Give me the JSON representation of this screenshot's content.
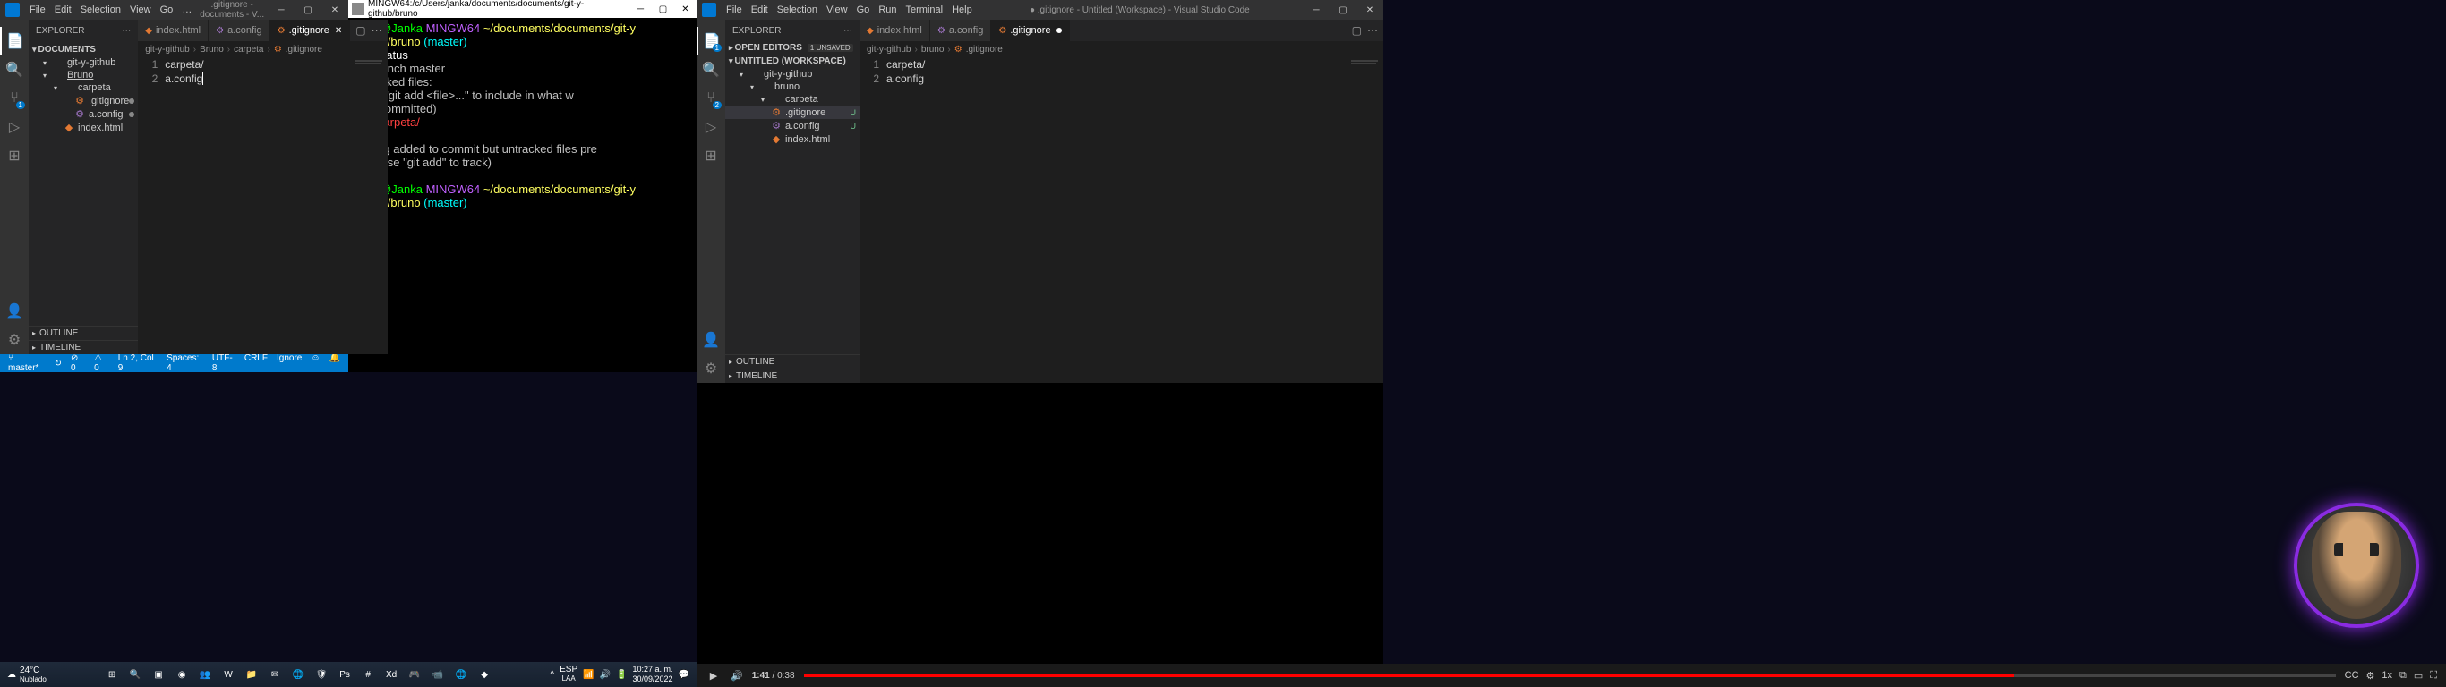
{
  "left_vscode": {
    "menu": [
      "File",
      "Edit",
      "Selection",
      "View",
      "Go"
    ],
    "title": ".gitignore - documents - V...",
    "tabs": [
      {
        "icon": "html",
        "label": "index.html",
        "active": false
      },
      {
        "icon": "config",
        "label": "a.config",
        "active": false
      },
      {
        "icon": "gitignore",
        "label": ".gitignore",
        "active": true
      }
    ],
    "breadcrumbs": [
      "git-y-github",
      "Bruno",
      "carpeta",
      ".gitignore"
    ],
    "explorer": {
      "title": "EXPLORER",
      "root": "DOCUMENTS",
      "tree": [
        {
          "type": "folder",
          "label": "git-y-github",
          "level": 0
        },
        {
          "type": "folder",
          "label": "Bruno",
          "level": 0,
          "underline": true
        },
        {
          "type": "folder",
          "label": "carpeta",
          "level": 1
        },
        {
          "type": "file",
          "label": ".gitignore",
          "icon": "gitignore",
          "level": 2,
          "modified": true
        },
        {
          "type": "file",
          "label": "a.config",
          "icon": "config",
          "level": 2,
          "modified": true
        },
        {
          "type": "file",
          "label": "index.html",
          "icon": "html",
          "level": 1
        }
      ],
      "panels": [
        "OUTLINE",
        "TIMELINE"
      ]
    },
    "editor": {
      "lines": [
        "carpeta/",
        "a.config"
      ]
    },
    "statusbar": {
      "branch": "master*",
      "sync": "↻",
      "errors": "⊘ 0",
      "warnings": "⚠ 0",
      "position": "Ln 2, Col 9",
      "spaces": "Spaces: 4",
      "encoding": "UTF-8",
      "eol": "CRLF",
      "lang": "Ignore",
      "feedback": "☺",
      "bell": "🔔"
    }
  },
  "terminal": {
    "title": "MINGW64:/c/Users/janka/documents/documents/git-y-github/bruno",
    "lines": [
      {
        "segments": [
          {
            "t": "janka@Janka ",
            "c": "green"
          },
          {
            "t": "MINGW64 ",
            "c": "purple"
          },
          {
            "t": "~/documents/documents/git-y",
            "c": "yellow"
          }
        ]
      },
      {
        "segments": [
          {
            "t": "-github/bruno ",
            "c": "yellow"
          },
          {
            "t": "(master)",
            "c": "cyan"
          }
        ]
      },
      {
        "segments": [
          {
            "t": "$ git status",
            "c": "white"
          }
        ]
      },
      {
        "segments": [
          {
            "t": "On branch master",
            "c": ""
          }
        ]
      },
      {
        "segments": [
          {
            "t": "Untracked files:",
            "c": ""
          }
        ]
      },
      {
        "segments": [
          {
            "t": "  (use \"git add <file>...\" to include in what w",
            "c": ""
          }
        ]
      },
      {
        "segments": [
          {
            "t": "ill be committed)",
            "c": ""
          }
        ]
      },
      {
        "segments": [
          {
            "t": "        carpeta/",
            "c": "red"
          }
        ]
      },
      {
        "segments": [
          {
            "t": "",
            "c": ""
          }
        ]
      },
      {
        "segments": [
          {
            "t": "nothing added to commit but untracked files pre",
            "c": ""
          }
        ]
      },
      {
        "segments": [
          {
            "t": "sent (use \"git add\" to track)",
            "c": ""
          }
        ]
      },
      {
        "segments": [
          {
            "t": "",
            "c": ""
          }
        ]
      },
      {
        "segments": [
          {
            "t": "janka@Janka ",
            "c": "green"
          },
          {
            "t": "MINGW64 ",
            "c": "purple"
          },
          {
            "t": "~/documents/documents/git-y",
            "c": "yellow"
          }
        ]
      },
      {
        "segments": [
          {
            "t": "-github/bruno ",
            "c": "yellow"
          },
          {
            "t": "(master)",
            "c": "cyan"
          }
        ]
      },
      {
        "segments": [
          {
            "t": "$",
            "c": "white"
          }
        ]
      }
    ]
  },
  "right_vscode": {
    "menu": [
      "File",
      "Edit",
      "Selection",
      "View",
      "Go",
      "Run",
      "Terminal",
      "Help"
    ],
    "title": "● .gitignore - Untitled (Workspace) - Visual Studio Code",
    "tabs": [
      {
        "icon": "html",
        "label": "index.html",
        "active": false
      },
      {
        "icon": "config",
        "label": "a.config",
        "active": false
      },
      {
        "icon": "gitignore",
        "label": ".gitignore",
        "active": true,
        "modified": true
      }
    ],
    "breadcrumbs": [
      "git-y-github",
      "bruno",
      ".gitignore"
    ],
    "explorer": {
      "title": "EXPLORER",
      "open_editors": "OPEN EDITORS",
      "unsaved": "1 UNSAVED",
      "root": "UNTITLED (WORKSPACE)",
      "tree": [
        {
          "type": "folder",
          "label": "git-y-github",
          "level": 0
        },
        {
          "type": "folder",
          "label": "bruno",
          "level": 1
        },
        {
          "type": "folder",
          "label": "carpeta",
          "level": 2
        },
        {
          "type": "file",
          "label": ".gitignore",
          "icon": "gitignore",
          "level": 2,
          "selected": true,
          "status": "U"
        },
        {
          "type": "file",
          "label": "a.config",
          "icon": "config",
          "level": 2,
          "status": "U"
        },
        {
          "type": "file",
          "label": "index.html",
          "icon": "html",
          "level": 2
        }
      ],
      "panels": [
        "OUTLINE",
        "TIMELINE"
      ]
    },
    "editor": {
      "lines": [
        "carpeta/",
        "a.config"
      ]
    }
  },
  "taskbar": {
    "weather": {
      "temp": "24°C",
      "desc": "Nublado"
    },
    "icons": [
      "start",
      "search",
      "taskview",
      "widgets",
      "teams",
      "word",
      "explorer",
      "outlook",
      "edge",
      "mcafee",
      "photoshop",
      "slack",
      "xd",
      "discord",
      "zoom",
      "chrome",
      "vscode"
    ],
    "tray": {
      "lang": "ESP",
      "region": "LAA",
      "time": "10:27 a. m.",
      "date": "30/09/2022"
    }
  },
  "video": {
    "current": "1:41",
    "total": "0:38",
    "speed": "1x"
  }
}
